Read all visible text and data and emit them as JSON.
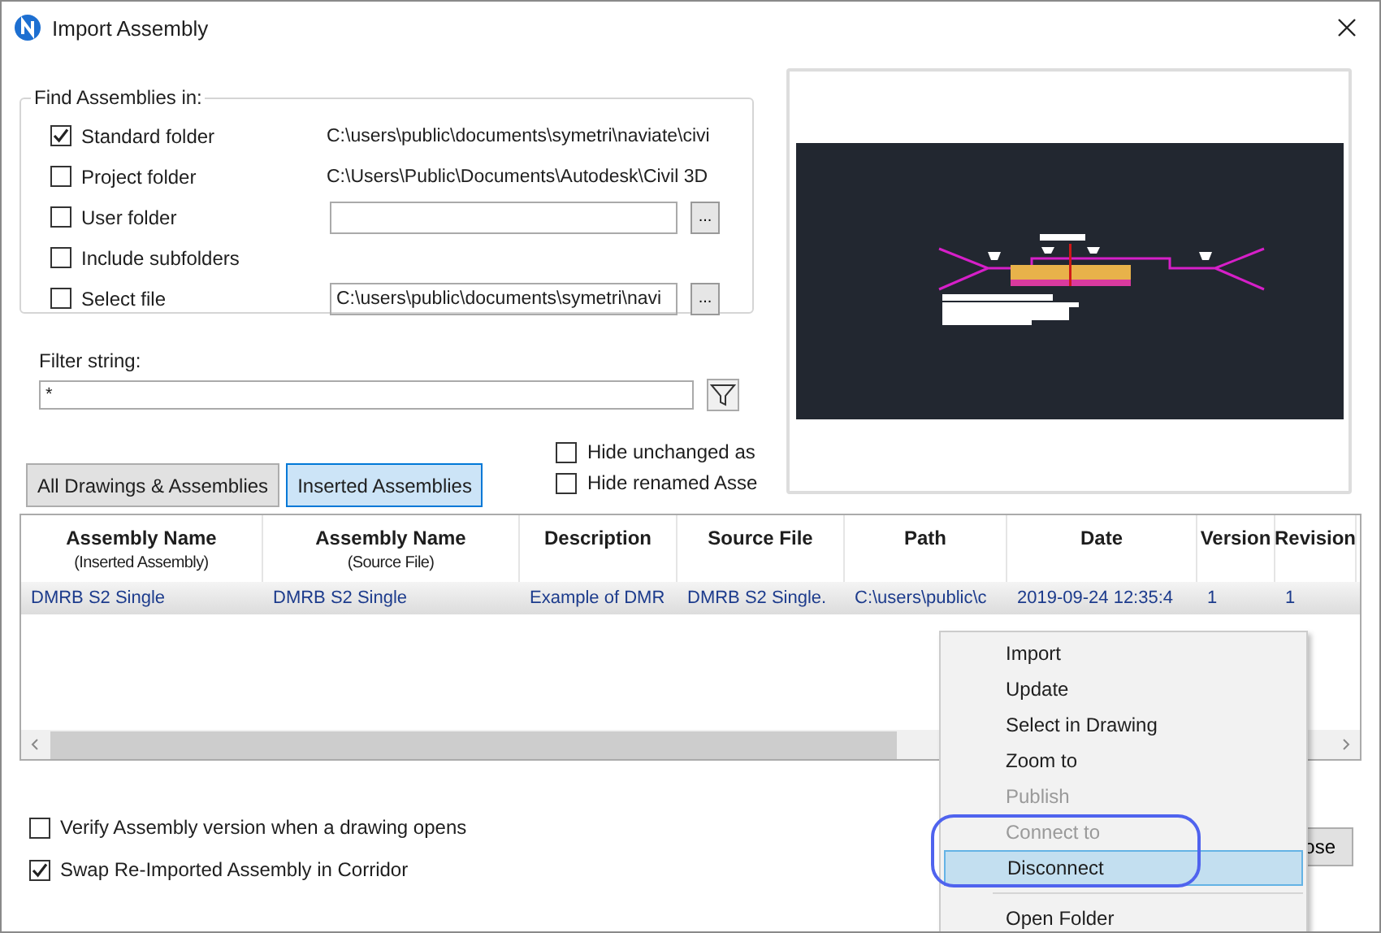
{
  "window": {
    "title": "Import Assembly"
  },
  "find_group": {
    "title": "Find Assemblies in:",
    "options": [
      {
        "kind": "path",
        "label": "Standard folder",
        "checked": true,
        "path": "C:\\users\\public\\documents\\symetri\\naviate\\civi"
      },
      {
        "kind": "path",
        "label": "Project folder",
        "checked": false,
        "path": "C:\\Users\\Public\\Documents\\Autodesk\\Civil 3D"
      },
      {
        "kind": "browse",
        "label": "User folder",
        "checked": false
      },
      {
        "kind": "plain",
        "label": "Include subfolders",
        "checked": false
      },
      {
        "kind": "browse",
        "label": "Select file",
        "checked": false,
        "value": "C:\\users\\public\\documents\\symetri\\navi"
      }
    ],
    "browse_label": "..."
  },
  "filter": {
    "label": "Filter string:",
    "value": "*"
  },
  "hide_options": [
    {
      "label": "Hide unchanged as",
      "checked": false
    },
    {
      "label": "Hide renamed Asse",
      "checked": false
    }
  ],
  "tabs": [
    {
      "label": "All Drawings & Assemblies",
      "selected": false
    },
    {
      "label": "Inserted Assemblies",
      "selected": true
    }
  ],
  "table": {
    "columns": [
      {
        "title": "Assembly Name",
        "subtitle": "(Inserted Assembly)"
      },
      {
        "title": "Assembly Name",
        "subtitle": "(Source File)"
      },
      {
        "title": "Description"
      },
      {
        "title": "Source File"
      },
      {
        "title": "Path"
      },
      {
        "title": "Date"
      },
      {
        "title": "Version"
      },
      {
        "title": "Revision"
      }
    ],
    "rows": [
      {
        "selected": true,
        "cells": [
          "DMRB S2 Single",
          "DMRB S2 Single",
          "Example of DMR",
          "DMRB S2 Single.",
          "C:\\users\\public\\c",
          "2019-09-24 12:35:4",
          "1",
          "1"
        ]
      }
    ]
  },
  "bottom_options": [
    {
      "label": "Verify Assembly version when a drawing opens",
      "checked": false
    },
    {
      "label": "Swap Re-Imported Assembly in Corridor",
      "checked": true
    }
  ],
  "close_button": {
    "label": "ose"
  },
  "context_menu": {
    "items": [
      {
        "kind": "item",
        "label": "Import",
        "disabled": false,
        "selected": false
      },
      {
        "kind": "item",
        "label": "Update",
        "disabled": false,
        "selected": false
      },
      {
        "kind": "item",
        "label": "Select in Drawing",
        "disabled": false,
        "selected": false
      },
      {
        "kind": "item",
        "label": "Zoom to",
        "disabled": false,
        "selected": false
      },
      {
        "kind": "item",
        "label": "Publish",
        "disabled": true,
        "selected": false
      },
      {
        "kind": "item",
        "label": "Connect to",
        "disabled": true,
        "selected": false
      },
      {
        "kind": "item",
        "label": "Disconnect",
        "disabled": false,
        "selected": true
      },
      {
        "kind": "separator"
      },
      {
        "kind": "item",
        "label": "Open Folder",
        "disabled": false,
        "selected": false
      }
    ]
  }
}
